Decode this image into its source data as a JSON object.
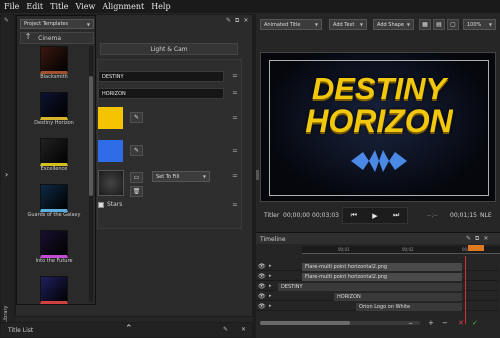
{
  "menu": [
    "File",
    "Edit",
    "Title",
    "View",
    "Alignment",
    "Help"
  ],
  "templates": {
    "title": "Project Templates",
    "folder": "Cinema",
    "items": [
      {
        "label": "Blacksmith",
        "bg": "#3a1810",
        "fg": "#a0522d"
      },
      {
        "label": "Destiny Horizon",
        "bg": "#0d1430",
        "fg": "#d6b52a"
      },
      {
        "label": "Excellence",
        "bg": "#222",
        "fg": "#d4c020"
      },
      {
        "label": "Guards of the Galaxy",
        "bg": "#0e2a45",
        "fg": "#5ab0e0"
      },
      {
        "label": "Into the Future",
        "bg": "#1a1030",
        "fg": "#c04cd0"
      },
      {
        "label": "",
        "bg": "#202060",
        "fg": "#d04040"
      }
    ]
  },
  "library_label": "Library",
  "title_list_label": "Title List",
  "props": {
    "tab": "Light & Cam",
    "field1": "DESTINY",
    "field2": "HORIZON",
    "fill_mode": "Set To Fill",
    "stars_label": "Stars",
    "color1": "#f5c400",
    "color2": "#2f6de8"
  },
  "toolbar": {
    "animated_title": "Animated Title",
    "add_text": "Add Text",
    "add_shape": "Add Shape",
    "zoom": "100%"
  },
  "preview": {
    "line1": "DESTINY",
    "line2": "HORIZON"
  },
  "transport": {
    "titler": "Titler",
    "time_current": "00;00;00",
    "time_total": "00;03;03",
    "time_right": "00;01;15",
    "nle": "NLE"
  },
  "timeline": {
    "title": "Timeline",
    "ticks": [
      "00;01",
      "00;02",
      "00;03"
    ],
    "tracks": [
      {
        "name": "Flare-multi point horizontal2.png"
      },
      {
        "name": "Flare-multi point horizontal2.png"
      },
      {
        "name": "DESTINY"
      },
      {
        "name": "HORIZON"
      },
      {
        "name": "Orion Logo on White"
      }
    ]
  }
}
